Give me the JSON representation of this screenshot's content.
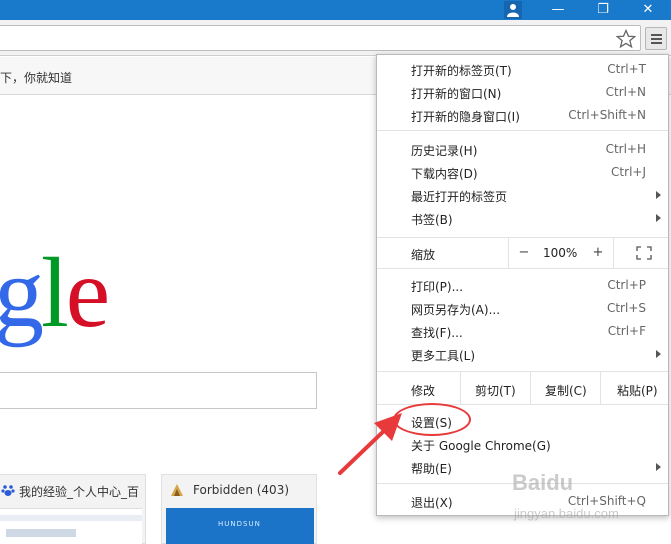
{
  "titlebar": {
    "user_icon": "user-icon",
    "minimize_icon": "minimize-icon",
    "restore_icon": "restore-icon",
    "close_icon": "close-icon",
    "minimize_glyph": "—",
    "restore_glyph": "❐",
    "close_glyph": "✕"
  },
  "toolbar": {
    "star_icon": "star-icon",
    "menu_icon": "hamburger-menu-icon"
  },
  "infobar": {
    "text": "下，你就知道"
  },
  "page": {
    "logo": {
      "g1": "g",
      "l": "l",
      "e": "e"
    },
    "tiles": [
      {
        "title": "我的经验_个人中心_百"
      },
      {
        "title": "Forbidden (403)",
        "thumb_text": "HUNDSUN"
      }
    ]
  },
  "menu": {
    "items": [
      {
        "label": "打开新的标签页(T)",
        "shortcut": "Ctrl+T"
      },
      {
        "label": "打开新的窗口(N)",
        "shortcut": "Ctrl+N"
      },
      {
        "label": "打开新的隐身窗口(I)",
        "shortcut": "Ctrl+Shift+N"
      },
      {
        "label": "历史记录(H)",
        "shortcut": "Ctrl+H"
      },
      {
        "label": "下载内容(D)",
        "shortcut": "Ctrl+J"
      },
      {
        "label": "最近打开的标签页",
        "shortcut": ""
      },
      {
        "label": "书签(B)",
        "shortcut": ""
      },
      {
        "label": "打印(P)...",
        "shortcut": "Ctrl+P"
      },
      {
        "label": "网页另存为(A)...",
        "shortcut": "Ctrl+S"
      },
      {
        "label": "查找(F)...",
        "shortcut": "Ctrl+F"
      },
      {
        "label": "更多工具(L)",
        "shortcut": ""
      },
      {
        "label": "设置(S)",
        "shortcut": ""
      },
      {
        "label": "关于 Google Chrome(G)",
        "shortcut": ""
      },
      {
        "label": "帮助(E)",
        "shortcut": ""
      },
      {
        "label": "退出(X)",
        "shortcut": "Ctrl+Shift+Q"
      }
    ],
    "zoom": {
      "label": "缩放",
      "minus": "−",
      "value": "100%",
      "plus": "+"
    },
    "edit": {
      "label": "修改",
      "cut": "剪切(T)",
      "copy": "复制(C)",
      "paste": "粘贴(P)"
    }
  },
  "annotation": {
    "highlight_color": "#e83a3a"
  },
  "watermark": {
    "text": "Baidu",
    "sub": "jingyan.baidu.com"
  }
}
